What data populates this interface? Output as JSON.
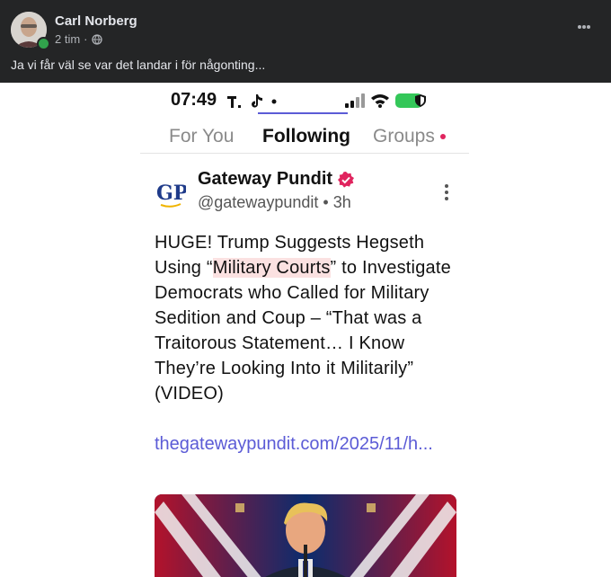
{
  "fb_post": {
    "author": "Carl Norberg",
    "time": "2 tim",
    "separator": "·",
    "text": "Ja vi får väl se var det landar i för någonting..."
  },
  "phone": {
    "status": {
      "time": "07:49",
      "wifi_icon": "wifi-icon",
      "battery_icon": "battery-icon"
    },
    "tabs": [
      {
        "label": "For You"
      },
      {
        "label": "Following",
        "active": true
      },
      {
        "label": "Groups"
      }
    ],
    "post": {
      "account_name": "Gateway Pundit",
      "logo_text": "GP",
      "handle": "@gatewaypundit",
      "dot": "•",
      "age": "3h",
      "body_before": "HUGE! Trump Suggests Hegseth Using “",
      "body_highlight": "Military Courts",
      "body_after": "” to Investigate Democrats who Called for Military Sedition and Coup – “That was a Traitorous Statement… I Know They’re Looking Into it Militarily” (VIDEO)",
      "link": "thegatewaypundit.com/2025/11/h..."
    }
  },
  "colors": {
    "fb_bg": "#242526",
    "accent": "#5b5bd6",
    "highlight": "#fbe1e1",
    "online": "#31a24c"
  }
}
